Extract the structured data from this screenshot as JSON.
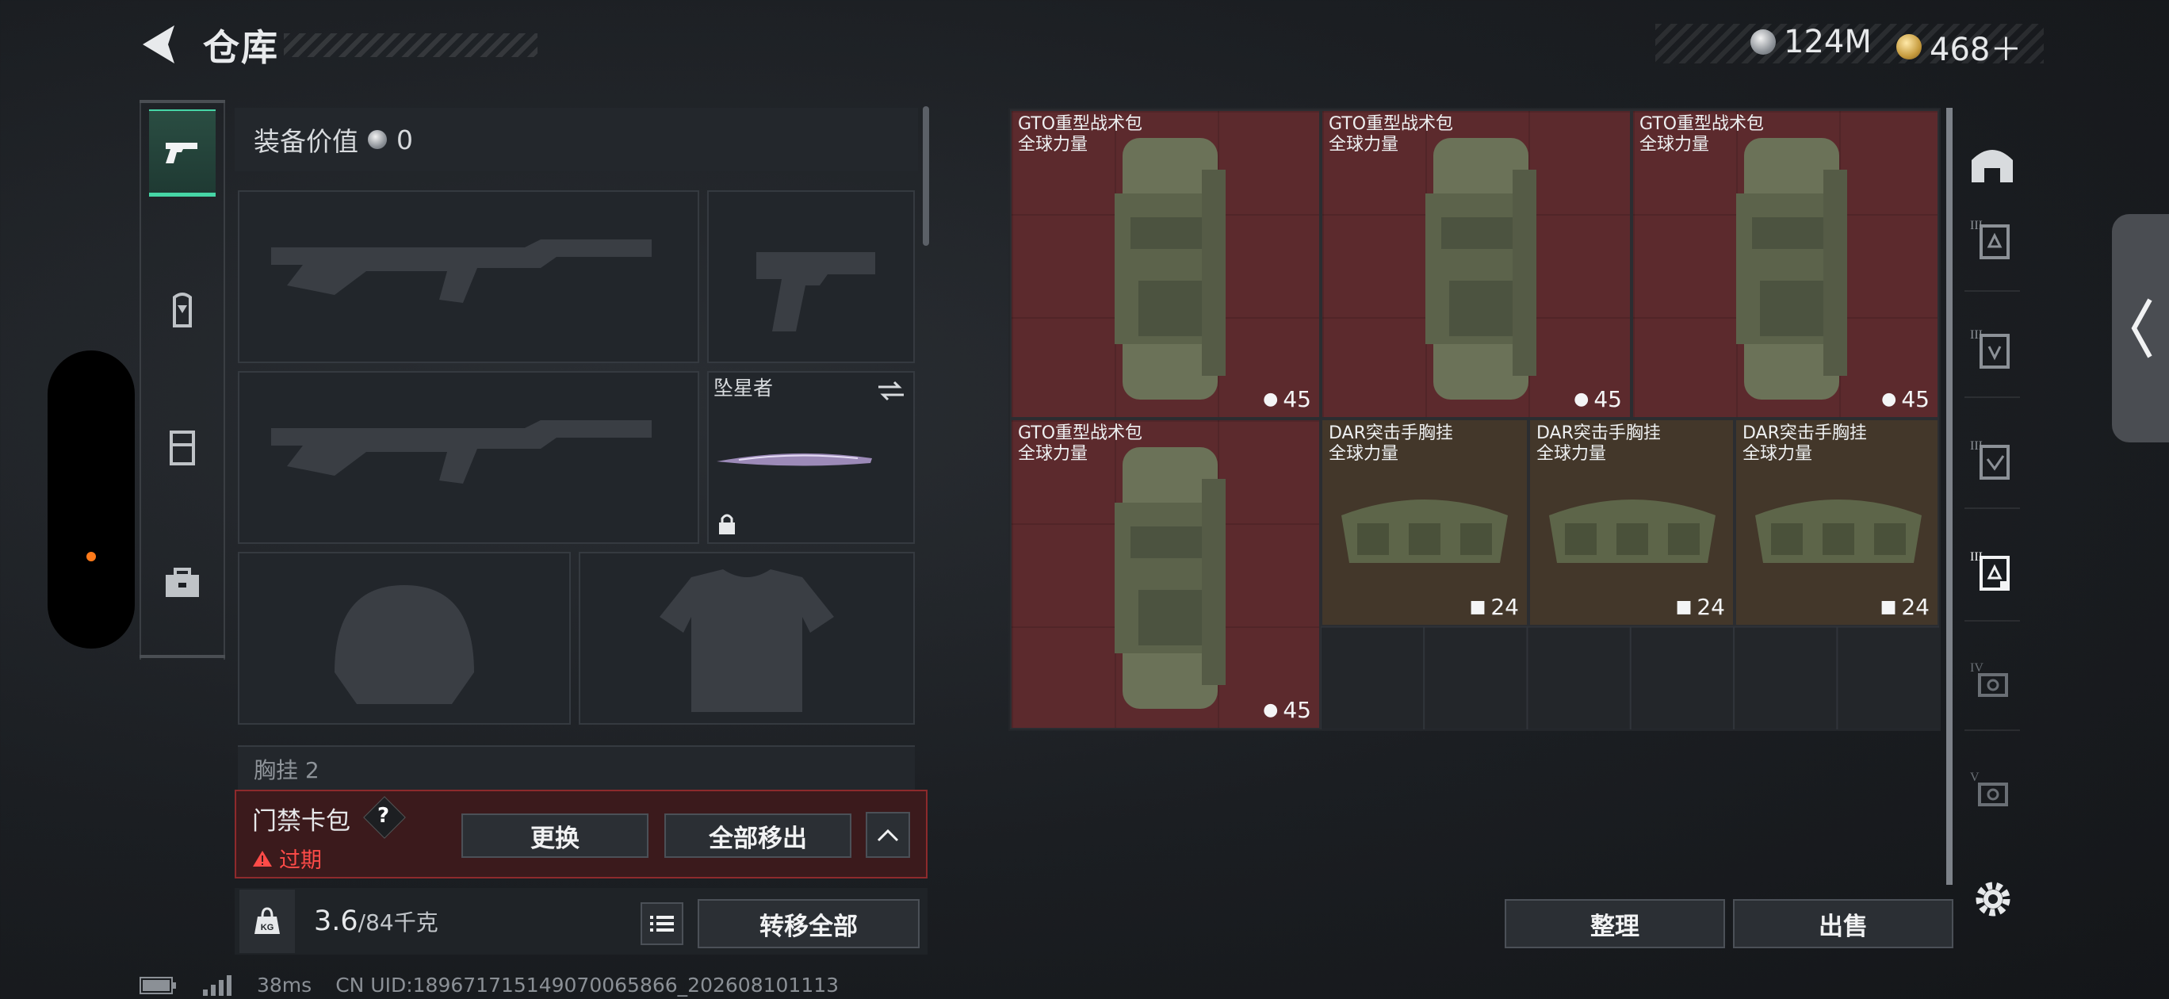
{
  "header": {
    "title": "仓库",
    "currency": [
      {
        "icon": "silver-coin-icon",
        "value": "124M"
      },
      {
        "icon": "gold-coin-icon",
        "value": "468＋"
      }
    ]
  },
  "left_rail": {
    "items": [
      {
        "name": "weapon-category-icon",
        "active": true
      },
      {
        "name": "backpack-category-icon",
        "active": false
      },
      {
        "name": "vest-category-icon",
        "active": false
      },
      {
        "name": "medkit-category-icon",
        "active": false
      }
    ]
  },
  "equipment": {
    "value_label": "装备价值",
    "value": "0",
    "melee_name": "坠星者",
    "chest_label": "胸挂 2"
  },
  "keycard": {
    "title": "门禁卡包",
    "help": "?",
    "status": "过期",
    "replace_button": "更换",
    "move_all_button": "全部移出"
  },
  "weight": {
    "icon_label": "KG",
    "current": "3.6",
    "max": "/84千克",
    "transfer_all_button": "转移全部"
  },
  "stash": {
    "items": [
      {
        "name": "GTO重型战术包",
        "brand": "全球力量",
        "count": "45",
        "type": "backpack"
      },
      {
        "name": "GTO重型战术包",
        "brand": "全球力量",
        "count": "45",
        "type": "backpack"
      },
      {
        "name": "GTO重型战术包",
        "brand": "全球力量",
        "count": "45",
        "type": "backpack"
      },
      {
        "name": "GTO重型战术包",
        "brand": "全球力量",
        "count": "45",
        "type": "backpack"
      },
      {
        "name": "DAR突击手胸挂",
        "brand": "全球力量",
        "count": "24",
        "type": "vest"
      },
      {
        "name": "DAR突击手胸挂",
        "brand": "全球力量",
        "count": "24",
        "type": "vest"
      },
      {
        "name": "DAR突击手胸挂",
        "brand": "全球力量",
        "count": "24",
        "type": "vest"
      }
    ],
    "sort_button": "整理",
    "sell_button": "出售"
  },
  "filters": [
    {
      "name": "all-filter-icon"
    },
    {
      "name": "tier-3-backpack-filter-icon",
      "tier": "III"
    },
    {
      "name": "tier-3-vest-filter-icon",
      "tier": "III"
    },
    {
      "name": "tier-3-armor-filter-icon",
      "tier": "III"
    },
    {
      "name": "tier-3-active-filter-icon",
      "tier": "III"
    },
    {
      "name": "tier-4-filter-icon",
      "tier": "IV"
    },
    {
      "name": "tier-5-filter-icon",
      "tier": "V"
    }
  ],
  "statusbar": {
    "ping": "38ms",
    "uid": "CN UID:189671715149070065866_202608101113"
  },
  "colors": {
    "accent": "#46d6a6",
    "warning": "#ff4b48",
    "item_red": "#5c2a2d",
    "item_brown": "#43372a"
  }
}
